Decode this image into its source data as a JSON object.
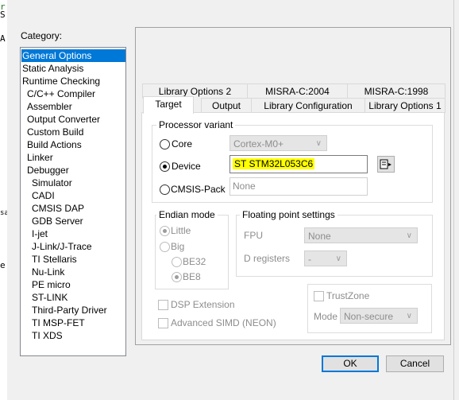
{
  "editor": {
    "chars": [
      "r",
      "S",
      "A",
      "sa",
      "e"
    ]
  },
  "dialog": {
    "category_label": "Category:",
    "categories": [
      {
        "label": "General Options"
      },
      {
        "label": "Static Analysis"
      },
      {
        "label": "Runtime Checking"
      },
      {
        "label": "C/C++ Compiler"
      },
      {
        "label": "Assembler"
      },
      {
        "label": "Output Converter"
      },
      {
        "label": "Custom Build"
      },
      {
        "label": "Build Actions"
      },
      {
        "label": "Linker"
      },
      {
        "label": "Debugger"
      },
      {
        "label": "Simulator"
      },
      {
        "label": "CADI"
      },
      {
        "label": "CMSIS DAP"
      },
      {
        "label": "GDB Server"
      },
      {
        "label": "I-jet"
      },
      {
        "label": "J-Link/J-Trace"
      },
      {
        "label": "TI Stellaris"
      },
      {
        "label": "Nu-Link"
      },
      {
        "label": "PE micro"
      },
      {
        "label": "ST-LINK"
      },
      {
        "label": "Third-Party Driver"
      },
      {
        "label": "TI MSP-FET"
      },
      {
        "label": "TI XDS"
      }
    ],
    "selected_category": "General Options",
    "tabs_back": [
      "Library Options 2",
      "MISRA-C:2004",
      "MISRA-C:1998"
    ],
    "tabs_front": [
      "Target",
      "Output",
      "Library Configuration",
      "Library Options 1"
    ],
    "active_tab": "Target",
    "processor": {
      "title": "Processor variant",
      "core_label": "Core",
      "core_value": "Cortex-M0+",
      "device_label": "Device",
      "device_value": "ST STM32L053C6",
      "cmsis_label": "CMSIS-Pack",
      "cmsis_value": "None",
      "highlight_color": "#ffff00"
    },
    "endian": {
      "title": "Endian mode",
      "little": "Little",
      "big": "Big",
      "be32": "BE32",
      "be8": "BE8"
    },
    "fp": {
      "title": "Floating point settings",
      "fpu_label": "FPU",
      "fpu_value": "None",
      "dreg_label": "D registers",
      "dreg_value": "-"
    },
    "dsp_label": "DSP Extension",
    "simd_label": "Advanced SIMD (NEON)",
    "trustzone": {
      "label": "TrustZone",
      "mode_label": "Mode",
      "mode_value": "Non-secure"
    },
    "ok": "OK",
    "cancel": "Cancel",
    "accent_color": "#0078d7"
  }
}
